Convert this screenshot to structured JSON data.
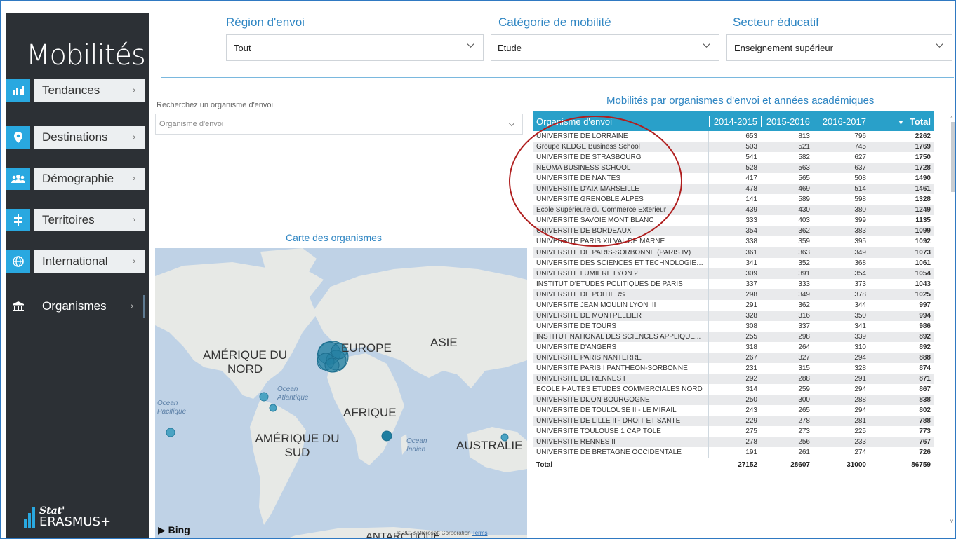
{
  "sidebar": {
    "title": "Mobilités",
    "items": [
      {
        "label": "Tendances",
        "icon": "bar-chart-icon"
      },
      {
        "label": "Destinations",
        "icon": "map-pin-icon"
      },
      {
        "label": "Démographie",
        "icon": "people-icon"
      },
      {
        "label": "Territoires",
        "icon": "signpost-icon"
      },
      {
        "label": "International",
        "icon": "globe-icon"
      },
      {
        "label": "Organismes",
        "icon": "institution-icon"
      }
    ],
    "logo": {
      "stat": "Stat'",
      "name": "ERASMUS+"
    }
  },
  "filters": {
    "region": {
      "label": "Région d'envoi",
      "value": "Tout"
    },
    "categorie": {
      "label": "Catégorie de mobilité",
      "value": "Etude"
    },
    "secteur": {
      "label": "Secteur éducatif",
      "value": "Enseignement supérieur"
    }
  },
  "search": {
    "label": "Recherchez un organisme d'envoi",
    "placeholder": "Organisme d'envoi"
  },
  "map": {
    "title": "Carte des organismes",
    "continents": [
      "AMÉRIQUE DU NORD",
      "EUROPE",
      "ASIE",
      "AFRIQUE",
      "AMÉRIQUE DU SUD",
      "AUSTRALIE",
      "ANTARCTIQUE"
    ],
    "oceans": [
      "Ocean Atlantique",
      "Ocean Pacifique",
      "Ocean Indien"
    ],
    "attribution": "Bing",
    "copyright": "© 2018 Microsoft Corporation",
    "terms": "Terms"
  },
  "table": {
    "title": "Mobilités par organismes d'envoi et années académiques",
    "headers": [
      "Organisme d'envoi",
      "2014-2015",
      "2015-2016",
      "2016-2017",
      "Total"
    ],
    "rows": [
      [
        "UNIVERSITE DE LORRAINE",
        "653",
        "813",
        "796",
        "2262"
      ],
      [
        "Groupe KEDGE Business School",
        "503",
        "521",
        "745",
        "1769"
      ],
      [
        "UNIVERSITE DE STRASBOURG",
        "541",
        "582",
        "627",
        "1750"
      ],
      [
        "NEOMA BUSINESS SCHOOL",
        "528",
        "563",
        "637",
        "1728"
      ],
      [
        "UNIVERSITE DE NANTES",
        "417",
        "565",
        "508",
        "1490"
      ],
      [
        "UNIVERSITE D'AIX MARSEILLE",
        "478",
        "469",
        "514",
        "1461"
      ],
      [
        "UNIVERSITE GRENOBLE ALPES",
        "141",
        "589",
        "598",
        "1328"
      ],
      [
        "Ecole Supérieure du Commerce Exterieur",
        "439",
        "430",
        "380",
        "1249"
      ],
      [
        "UNIVERSITE SAVOIE MONT BLANC",
        "333",
        "403",
        "399",
        "1135"
      ],
      [
        "UNIVERSITE DE BORDEAUX",
        "354",
        "362",
        "383",
        "1099"
      ],
      [
        "UNIVERSITE PARIS XII VAL DE MARNE",
        "338",
        "359",
        "395",
        "1092"
      ],
      [
        "UNIVERSITE DE PARIS-SORBONNE (PARIS IV)",
        "361",
        "363",
        "349",
        "1073"
      ],
      [
        "UNIVERSITE DES SCIENCES ET TECHNOLOGIES...",
        "341",
        "352",
        "368",
        "1061"
      ],
      [
        "UNIVERSITE LUMIERE LYON 2",
        "309",
        "391",
        "354",
        "1054"
      ],
      [
        "INSTITUT D'ETUDES POLITIQUES DE PARIS",
        "337",
        "333",
        "373",
        "1043"
      ],
      [
        "UNIVERSITE DE POITIERS",
        "298",
        "349",
        "378",
        "1025"
      ],
      [
        "UNIVERSITE JEAN MOULIN LYON III",
        "291",
        "362",
        "344",
        "997"
      ],
      [
        "UNIVERSITE DE MONTPELLIER",
        "328",
        "316",
        "350",
        "994"
      ],
      [
        "UNIVERSITE DE TOURS",
        "308",
        "337",
        "341",
        "986"
      ],
      [
        "INSTITUT NATIONAL DES SCIENCES APPLIQUE...",
        "255",
        "298",
        "339",
        "892"
      ],
      [
        "UNIVERSITE D'ANGERS",
        "318",
        "264",
        "310",
        "892"
      ],
      [
        "UNIVERSITE PARIS NANTERRE",
        "267",
        "327",
        "294",
        "888"
      ],
      [
        "UNIVERSITE PARIS I PANTHEON-SORBONNE",
        "231",
        "315",
        "328",
        "874"
      ],
      [
        "UNIVERSITE DE RENNES I",
        "292",
        "288",
        "291",
        "871"
      ],
      [
        "ECOLE HAUTES ETUDES COMMERCIALES NORD",
        "314",
        "259",
        "294",
        "867"
      ],
      [
        "UNIVERSITE DIJON BOURGOGNE",
        "250",
        "300",
        "288",
        "838"
      ],
      [
        "UNIVERSITE DE TOULOUSE II - LE MIRAIL",
        "243",
        "265",
        "294",
        "802"
      ],
      [
        "UNIVERSITE DE LILLE II - DROIT ET SANTE",
        "229",
        "278",
        "281",
        "788"
      ],
      [
        "UNIVERSITE TOULOUSE 1 CAPITOLE",
        "275",
        "273",
        "225",
        "773"
      ],
      [
        "UNIVERSITE RENNES II",
        "278",
        "256",
        "233",
        "767"
      ],
      [
        "UNIVERSITE DE BRETAGNE OCCIDENTALE",
        "191",
        "261",
        "274",
        "726"
      ]
    ],
    "footer": [
      "Total",
      "27152",
      "28607",
      "31000",
      "86759"
    ]
  }
}
